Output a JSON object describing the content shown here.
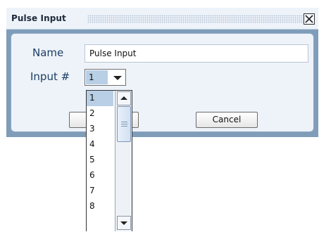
{
  "dialog": {
    "title": "Pulse Input",
    "close_icon": "close-x-icon"
  },
  "form": {
    "name_label": "Name",
    "name_value": "Pulse Input",
    "input_label": "Input #",
    "input_value": "1"
  },
  "buttons": {
    "ok_label": "",
    "cancel_label": "Cancel"
  },
  "dropdown": {
    "options": [
      "1",
      "2",
      "3",
      "4",
      "5",
      "6",
      "7",
      "8"
    ],
    "selected": "1"
  },
  "colors": {
    "selection": "#b8cfe5",
    "label_text": "#1c3d63",
    "frame": "#7f9db9"
  }
}
